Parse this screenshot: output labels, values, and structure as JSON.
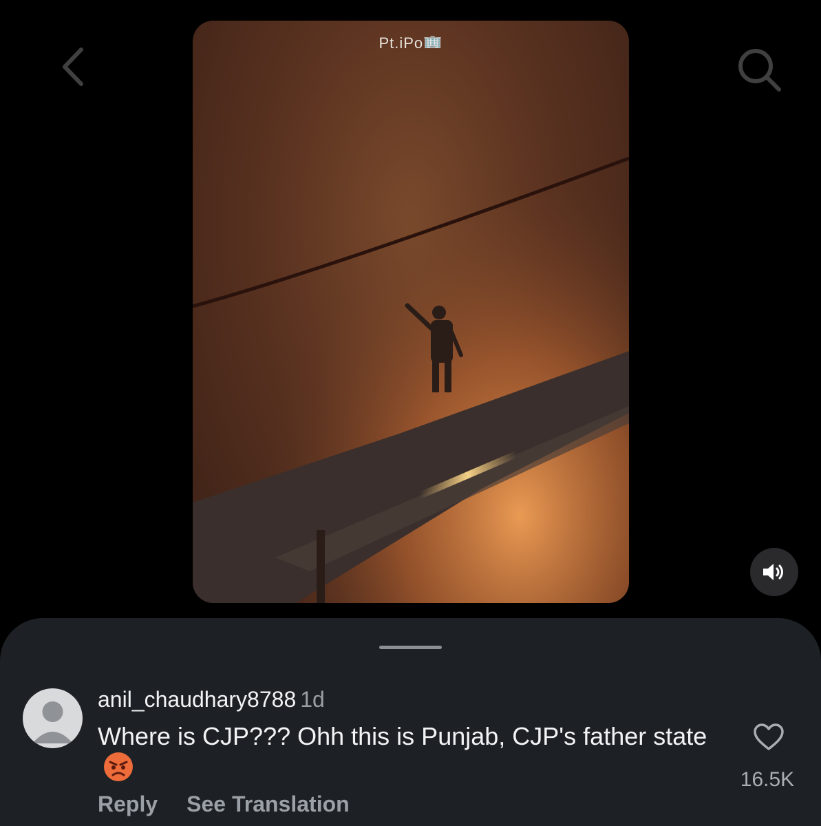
{
  "video": {
    "caption": "Pt.iPo🏢"
  },
  "icons": {
    "back": "chevron-left-icon",
    "search": "search-icon",
    "volume": "speaker-volume-icon",
    "like": "heart-icon",
    "avatar": "default-avatar-icon",
    "emoji": "angry-face-emoji"
  },
  "comment": {
    "username": "anil_chaudhary8788",
    "time": "1d",
    "text": "Where is CJP??? Ohh this is Punjab, CJP's father state",
    "like_count": "16.5K",
    "reply_label": "Reply",
    "translate_label": "See Translation"
  },
  "colors": {
    "sheet_background": "#1d2125",
    "secondary_text": "#9aa0a6"
  }
}
